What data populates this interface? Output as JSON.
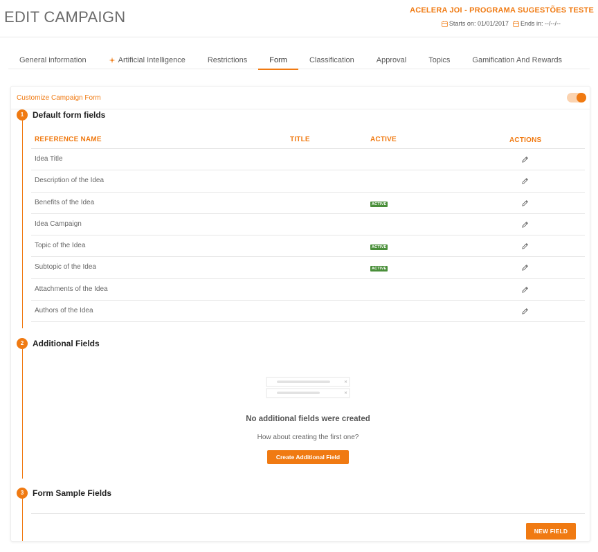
{
  "header": {
    "title": "EDIT CAMPAIGN",
    "campaign_name": "ACELERA JOI - PROGRAMA SUGESTÕES TESTE",
    "starts_label": "Starts on: 01/01/2017",
    "ends_label": "Ends in: --/--/--"
  },
  "tabs": [
    {
      "label": "General information"
    },
    {
      "label": "Artificial Intelligence"
    },
    {
      "label": "Restrictions"
    },
    {
      "label": "Form"
    },
    {
      "label": "Classification"
    },
    {
      "label": "Approval"
    },
    {
      "label": "Topics"
    },
    {
      "label": "Gamification And Rewards"
    }
  ],
  "active_tab": "Form",
  "customize": {
    "label": "Customize Campaign Form",
    "enabled": true
  },
  "sections": {
    "default": {
      "number": "1",
      "title": "Default form fields"
    },
    "additional": {
      "number": "2",
      "title": "Additional Fields"
    },
    "sample": {
      "number": "3",
      "title": "Form Sample Fields"
    }
  },
  "table": {
    "headers": {
      "reference_name": "REFERENCE NAME",
      "title": "TITLE",
      "active": "ACTIVE",
      "actions": "ACTIONS"
    },
    "rows": [
      {
        "name": "Idea Title",
        "active": ""
      },
      {
        "name": "Description of the Idea",
        "active": ""
      },
      {
        "name": "Benefits of the Idea",
        "active": "ACTIVE"
      },
      {
        "name": "Idea Campaign",
        "active": ""
      },
      {
        "name": "Topic of the Idea",
        "active": "ACTIVE"
      },
      {
        "name": "Subtopic of the Idea",
        "active": "ACTIVE"
      },
      {
        "name": "Attachments of the Idea",
        "active": ""
      },
      {
        "name": "Authors of the Idea",
        "active": ""
      }
    ]
  },
  "empty_state": {
    "title": "No additional fields were created",
    "subtitle": "How about creating the first one?",
    "button": "Create Additional Field"
  },
  "new_field_button": "NEW FIELD",
  "colors": {
    "accent": "#f07a12",
    "active_badge": "#4a8f3a"
  },
  "icons": {
    "calendar": "calendar-icon",
    "ai": "sparkle-icon",
    "edit": "pencil-icon"
  }
}
